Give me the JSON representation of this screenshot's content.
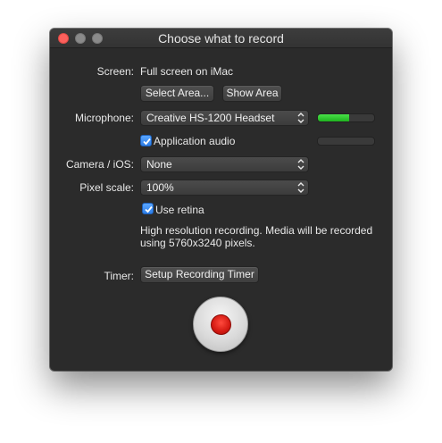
{
  "window": {
    "title": "Choose what to record"
  },
  "screen": {
    "label": "Screen:",
    "value": "Full screen on iMac",
    "select_area_button": "Select Area...",
    "show_area_button": "Show Area"
  },
  "microphone": {
    "label": "Microphone:",
    "selected": "Creative HS-1200 Headset",
    "level_fraction": 0.55,
    "app_audio_label": "Application audio",
    "app_audio_checked": true,
    "app_audio_level_fraction": 0.0
  },
  "camera": {
    "label": "Camera / iOS:",
    "selected": "None"
  },
  "pixel_scale": {
    "label": "Pixel scale:",
    "selected": "100%",
    "retina_label": "Use retina",
    "retina_checked": true,
    "note_line1": "High resolution recording. Media will be recorded",
    "note_line2": "using 5760x3240 pixels."
  },
  "timer": {
    "label": "Timer:",
    "button": "Setup Recording Timer"
  },
  "colors": {
    "window_bg": "#2b2b2b",
    "meter_green": "#2fc42f",
    "record_red": "#d41a12",
    "checkbox_blue": "#2d7ee8"
  }
}
